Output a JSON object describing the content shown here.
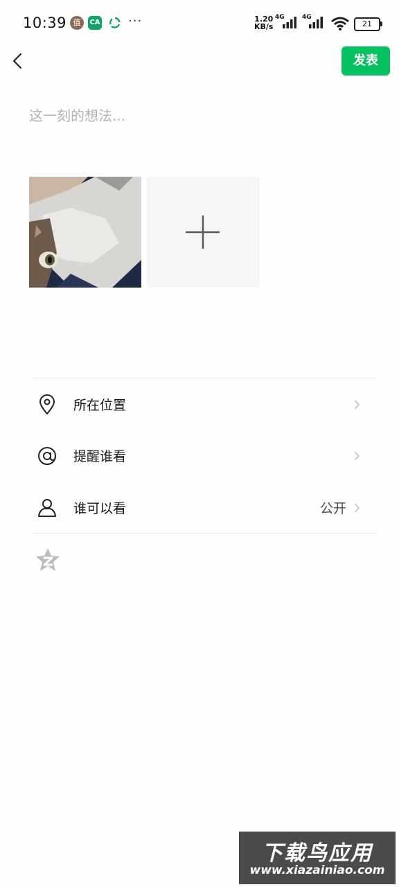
{
  "status_bar": {
    "time": "10:39",
    "notif_zhi": "值",
    "notif_ca": "CA",
    "more": "···",
    "net_speed_value": "1.20",
    "net_speed_unit": "KB/s",
    "sim1_label": "4G",
    "sim2_label": "4G",
    "battery": "21"
  },
  "header": {
    "publish_label": "发表"
  },
  "compose": {
    "placeholder": "这一刻的想法..."
  },
  "options": {
    "location_label": "所在位置",
    "remind_label": "提醒谁看",
    "visibility_label": "谁可以看",
    "visibility_value": "公开"
  },
  "watermark": {
    "title": "下载鸟应用",
    "url": "www.xiazainiao.com"
  },
  "colors": {
    "accent": "#07c160",
    "placeholder": "#b2b2b2"
  },
  "icons": [
    "back-icon",
    "location-pin-icon",
    "at-icon",
    "person-icon",
    "chevron-right-icon",
    "plus-icon",
    "z-star-icon"
  ]
}
